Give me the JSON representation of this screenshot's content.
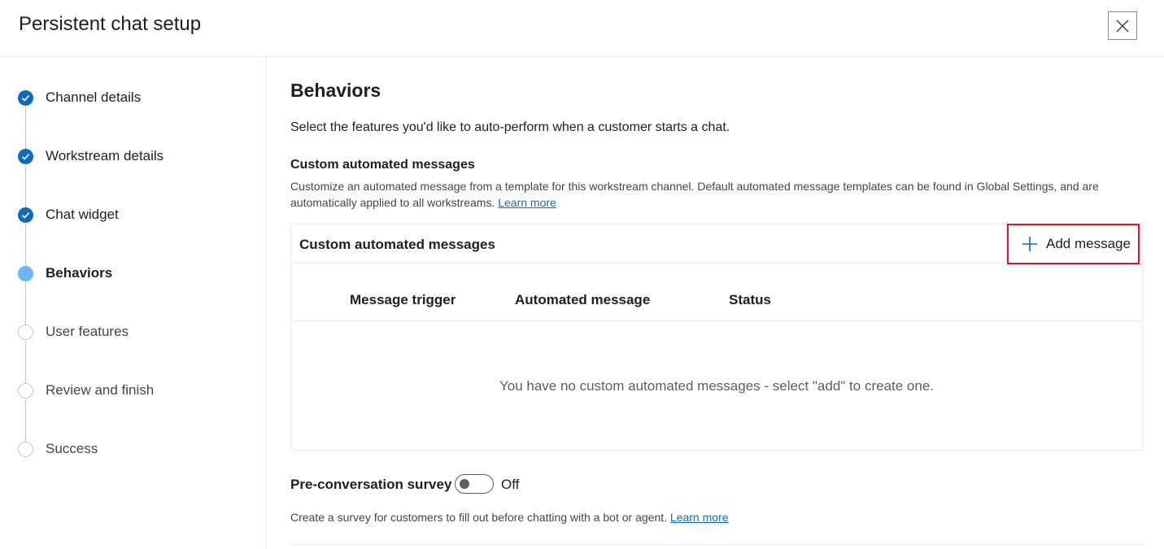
{
  "header": {
    "title": "Persistent chat setup",
    "close_icon": "close-icon"
  },
  "steps": [
    {
      "label": "Channel details",
      "state": "done"
    },
    {
      "label": "Workstream details",
      "state": "done"
    },
    {
      "label": "Chat widget",
      "state": "done"
    },
    {
      "label": "Behaviors",
      "state": "current"
    },
    {
      "label": "User features",
      "state": "todo"
    },
    {
      "label": "Review and finish",
      "state": "todo"
    },
    {
      "label": "Success",
      "state": "todo"
    }
  ],
  "main": {
    "title": "Behaviors",
    "intro": "Select the features you'd like to auto-perform when a customer starts a chat.",
    "custom_messages": {
      "title": "Custom automated messages",
      "description": "Customize an automated message from a template for this workstream channel. Default automated message templates can be found in Global Settings, and are automatically applied to all workstreams.",
      "learn_more": "Learn more",
      "card_title": "Custom automated messages",
      "add_button": "Add message",
      "columns": [
        "Message trigger",
        "Automated message",
        "Status"
      ],
      "empty_message": "You have no custom automated messages - select \"add\" to create one."
    },
    "survey": {
      "label": "Pre-conversation survey",
      "toggle_state": "Off",
      "toggle_on": false,
      "description": "Create a survey for customers to fill out before chatting with a bot or agent.",
      "learn_more": "Learn more"
    }
  },
  "colors": {
    "accent": "#0f6cbd",
    "current_step": "#6cb4f5",
    "highlight_border": "#e81123"
  }
}
